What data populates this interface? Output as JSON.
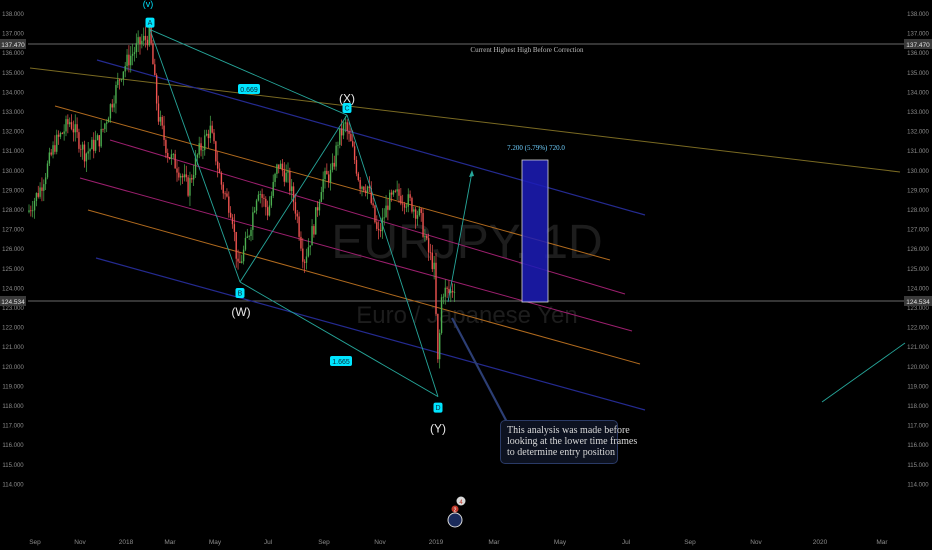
{
  "chart_data": {
    "type": "line",
    "title": "EURJPY, 1D",
    "watermark": {
      "symbol": "EURJPY, 1D",
      "description": "Euro / Japanese Yen"
    },
    "x_tick_labels": [
      "Sep",
      "Nov",
      "2018",
      "Mar",
      "May",
      "Jul",
      "Sep",
      "Nov",
      "2019",
      "Mar",
      "May",
      "Jul",
      "Sep",
      "Nov",
      "2020",
      "Mar"
    ],
    "y_tick_labels": [
      "138.000",
      "137.000",
      "136.000",
      "135.000",
      "134.000",
      "133.000",
      "132.000",
      "131.000",
      "130.000",
      "129.000",
      "128.000",
      "127.000",
      "126.000",
      "125.000",
      "124.000",
      "123.000",
      "122.000",
      "121.000",
      "120.000",
      "119.000",
      "118.000",
      "117.000",
      "116.000",
      "115.000",
      "114.000"
    ],
    "ylim": [
      113.6,
      138.6
    ],
    "current_price": "124.534",
    "high_price": "137.470",
    "high_line_label": "Current Highest High Before Correction",
    "wave_points": [
      {
        "id": "A",
        "label": "A",
        "price": 137.9
      },
      {
        "id": "B",
        "label": "B",
        "price": 124.9
      },
      {
        "id": "C",
        "label": "C",
        "price": 133.5
      },
      {
        "id": "D",
        "label": "D",
        "price": 119.0
      }
    ],
    "wave_labels": [
      {
        "text": "(v)",
        "price": 139.6
      },
      {
        "text": "(W)",
        "price": 123.3
      },
      {
        "text": "(X)",
        "price": 134.3
      },
      {
        "text": "(Y)",
        "price": 117.3
      }
    ],
    "ratio_labels": [
      "0.669",
      "1.665"
    ],
    "target_box_label": "7.200 (5.79%) 720.0",
    "annotation_lines": [
      "This analysis was made before",
      "looking at the lower time frames",
      " to determine entry position"
    ],
    "event_badges": [
      "4",
      "2"
    ],
    "colors": {
      "background": "#000000",
      "up_candle": "#4caf50",
      "down_candle": "#ef5350",
      "wave_lines": "#26a69a",
      "label_bg": "#00e5ff",
      "channel_orange": "#b06a1e",
      "channel_magenta": "#9c1f6e",
      "channel_blue": "#242a90",
      "target_box": "#1c1cb8",
      "axis_text": "#8c8c8c"
    }
  }
}
